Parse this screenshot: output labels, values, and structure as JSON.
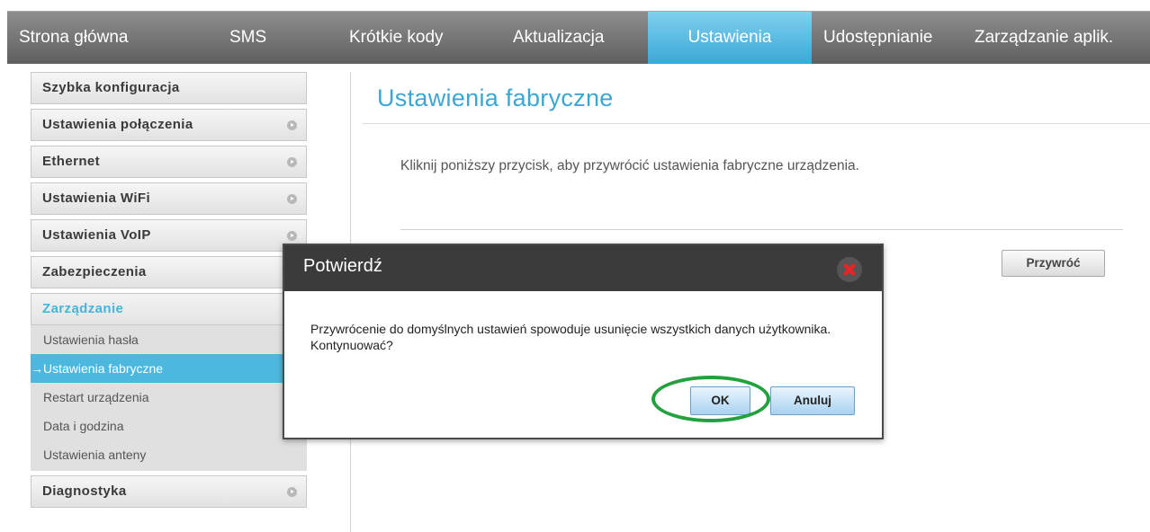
{
  "nav": {
    "items": [
      {
        "label": "Strona główna",
        "active": false
      },
      {
        "label": "SMS",
        "active": false
      },
      {
        "label": "Krótkie kody",
        "active": false
      },
      {
        "label": "Aktualizacja",
        "active": false
      },
      {
        "label": "Ustawienia",
        "active": true
      },
      {
        "label": "Udostępnianie",
        "active": false
      },
      {
        "label": "Zarządzanie aplik.",
        "active": false
      }
    ]
  },
  "sidebar": {
    "sections": [
      {
        "label": "Szybka konfiguracja"
      },
      {
        "label": "Ustawienia połączenia"
      },
      {
        "label": "Ethernet"
      },
      {
        "label": "Ustawienia WiFi"
      },
      {
        "label": "Ustawienia VoIP"
      },
      {
        "label": "Zabezpieczenia"
      },
      {
        "label": "Zarządzanie"
      },
      {
        "label": "Diagnostyka"
      }
    ],
    "submenu": [
      {
        "label": "Ustawienia hasła"
      },
      {
        "label": "→Ustawienia fabryczne"
      },
      {
        "label": "Restart urządzenia"
      },
      {
        "label": "Data i godzina"
      },
      {
        "label": "Ustawienia anteny"
      }
    ]
  },
  "main": {
    "title": "Ustawienia fabryczne",
    "description": "Kliknij poniższy przycisk, aby przywrócić ustawienia fabryczne urządzenia.",
    "restore_label": "Przywróć"
  },
  "dialog": {
    "title": "Potwierdź",
    "message": "Przywrócenie do domyślnych ustawień spowoduje usunięcie wszystkich danych użytkownika. Kontynuować?",
    "ok_label": "OK",
    "cancel_label": "Anuluj"
  },
  "colors": {
    "accent": "#3ba7d2",
    "nav_bg": "#6e6e6e",
    "highlight_ring": "#22a23e",
    "close_x": "#ee2222"
  }
}
